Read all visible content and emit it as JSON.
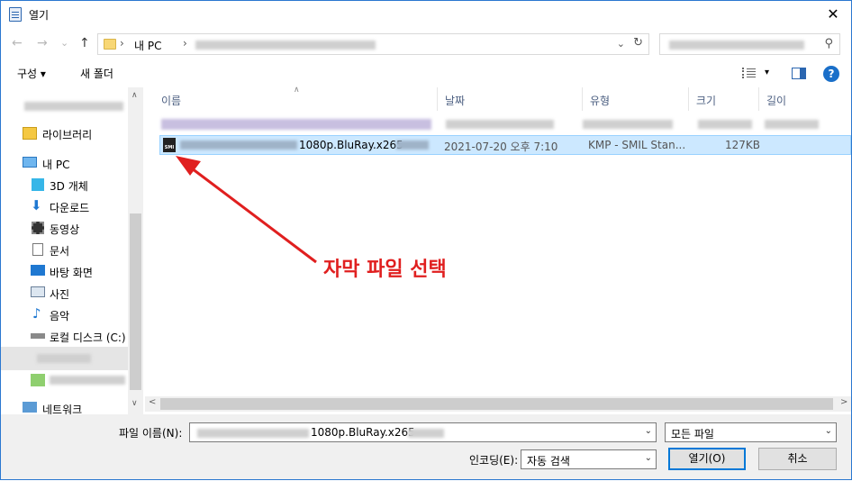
{
  "window": {
    "title": "열기",
    "close_glyph": "✕"
  },
  "nav": {
    "back": "←",
    "forward": "→",
    "recent": "⌄",
    "up": "↑",
    "breadcrumb_root": "내 PC",
    "chevron": "›"
  },
  "toolbar": {
    "organize": "구성 ▾",
    "new_folder": "새 폴더",
    "view_dd": "▾",
    "help": "?"
  },
  "sidebar": {
    "items": [
      {
        "label": "라이브러리",
        "icon": "library-icon"
      },
      {
        "label": "내 PC",
        "icon": "pc-icon"
      },
      {
        "label": "3D 개체",
        "icon": "3d-objects-icon"
      },
      {
        "label": "다운로드",
        "icon": "download-icon"
      },
      {
        "label": "동영상",
        "icon": "video-icon"
      },
      {
        "label": "문서",
        "icon": "document-icon"
      },
      {
        "label": "바탕 화면",
        "icon": "desktop-icon"
      },
      {
        "label": "사진",
        "icon": "pictures-icon"
      },
      {
        "label": "음악",
        "icon": "music-icon"
      },
      {
        "label": "로컬 디스크 (C:)",
        "icon": "disk-icon"
      },
      {
        "label": "네트워크",
        "icon": "network-icon"
      }
    ]
  },
  "columns": {
    "name": "이름",
    "date": "날짜",
    "type": "유형",
    "size": "크기",
    "length": "길이"
  },
  "selected_file": {
    "name_suffix": "1080p.BluRay.x265",
    "date": "2021-07-20 오후 7:10",
    "type": "KMP - SMIL Stan...",
    "size": "127KB",
    "icon_text": "SMI"
  },
  "bottom": {
    "filename_label": "파일 이름(N):",
    "filename_value": "1080p.BluRay.x265-",
    "filetype_value": "모든 파일",
    "encoding_label": "인코딩(E):",
    "encoding_value": "자동 검색",
    "open_button": "열기(O)",
    "cancel_button": "취소"
  },
  "annotation": {
    "text": "자막 파일 선택",
    "color": "#e01f1f"
  }
}
